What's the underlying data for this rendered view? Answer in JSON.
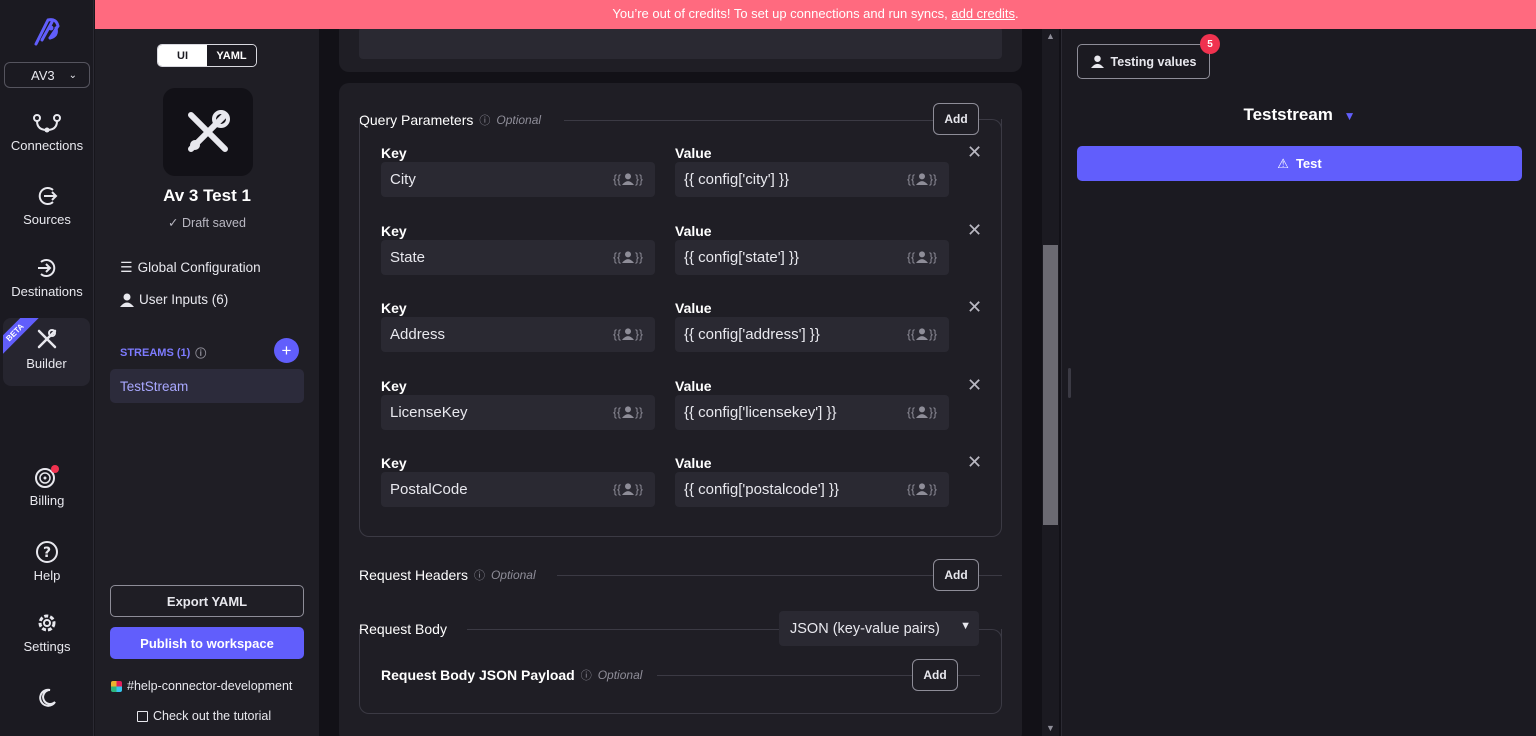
{
  "banner": {
    "text": "You’re out of credits! To set up connections and run syncs,",
    "link": "add credits",
    "end": "."
  },
  "nav": {
    "workspace": "AV3",
    "connections": "Connections",
    "sources": "Sources",
    "destinations": "Destinations",
    "builder": "Builder",
    "beta": "BETA",
    "billing": "Billing",
    "help": "Help",
    "settings": "Settings"
  },
  "sidebar": {
    "mode_ui": "UI",
    "mode_yaml": "YAML",
    "connector_name": "Av 3 Test 1",
    "draft_status": "Draft saved",
    "global_config": "Global Configuration",
    "user_inputs": "User Inputs (6)",
    "streams_label": "STREAMS (1)",
    "stream_item": "TestStream",
    "export_yaml": "Export YAML",
    "publish": "Publish to workspace",
    "slack_channel": "#help-connector-development",
    "tutorial": "Check out the tutorial"
  },
  "main": {
    "query_params": {
      "title": "Query Parameters",
      "optional": "Optional",
      "add": "Add",
      "key_label": "Key",
      "value_label": "Value",
      "rows": [
        {
          "key": "City",
          "value": "{{ config['city'] }}"
        },
        {
          "key": "State",
          "value": "{{ config['state'] }}"
        },
        {
          "key": "Address",
          "value": "{{ config['address'] }}"
        },
        {
          "key": "LicenseKey",
          "value": "{{ config['licensekey'] }}"
        },
        {
          "key": "PostalCode",
          "value": "{{ config['postalcode'] }}"
        }
      ]
    },
    "request_headers": {
      "title": "Request Headers",
      "optional": "Optional",
      "add": "Add"
    },
    "request_body": {
      "title": "Request Body",
      "type_select": "JSON (key-value pairs)",
      "payload_title": "Request Body JSON Payload",
      "optional": "Optional",
      "add": "Add"
    }
  },
  "right": {
    "testing_values": "Testing values",
    "testing_badge": "5",
    "stream_name": "Teststream",
    "test_button": "Test"
  },
  "colors": {
    "accent": "#615efc",
    "banner": "#ff6a7f",
    "badge": "#f0324f"
  }
}
